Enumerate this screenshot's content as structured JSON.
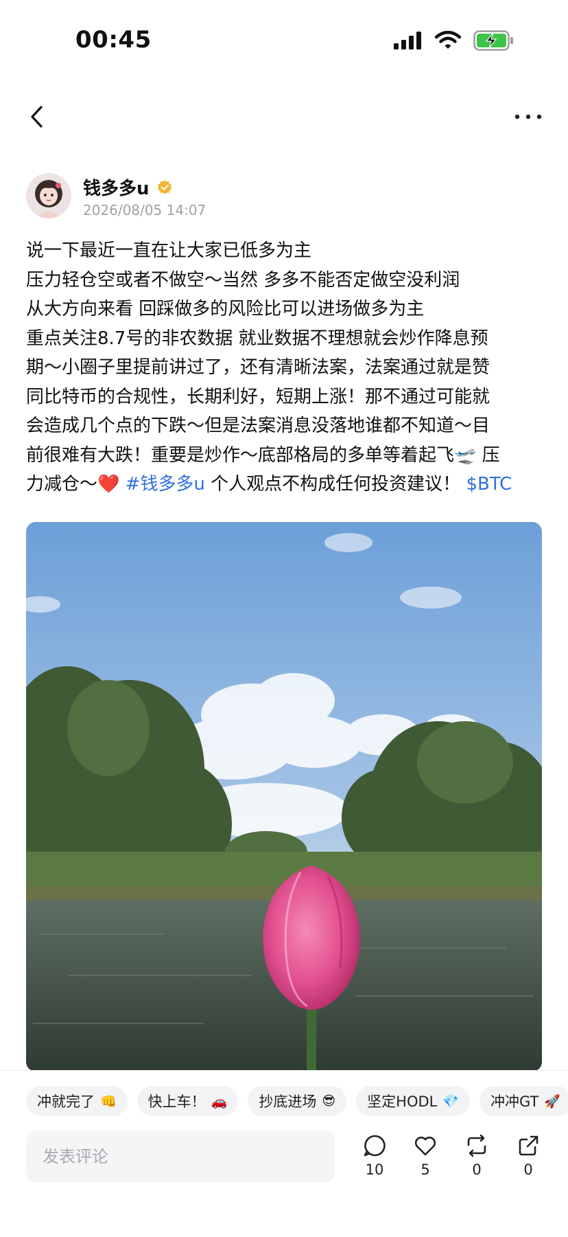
{
  "status_bar": {
    "time": "00:45"
  },
  "author": {
    "name": "钱多多u",
    "post_time": "2026/08/05 14:07"
  },
  "post": {
    "lines": [
      "说一下最近一直在让大家已低多为主",
      "压力轻仓空或者不做空～当然 多多不能否定做空没利润",
      "从大方向来看 回踩做多的风险比可以进场做多为主",
      "重点关注8.7号的非农数据  就业数据不理想就会炒作降息预",
      "期～小圈子里提前讲过了，还有清晰法案，法案通过就是赞",
      "同比特币的合规性，长期利好，短期上涨！那不通过可能就",
      "会造成几个点的下跌～但是法案消息没落地谁都不知道～目",
      "前很难有大跌！重要是炒作～底部格局的多单等着起飞🛫 压"
    ],
    "last_line_prefix": "力减仓～❤️ ",
    "hashtag": "#钱多多u",
    "last_line_middle": " 个人观点不构成任何投资建议！ ",
    "ticker": "$BTC"
  },
  "chips": [
    {
      "label": "冲就完了",
      "emoji": "👊"
    },
    {
      "label": "快上车！",
      "emoji": "🚗"
    },
    {
      "label": "抄底进场",
      "emoji": "😎"
    },
    {
      "label": "坚定HODL",
      "emoji": "💎"
    },
    {
      "label": "冲冲GT",
      "emoji": "🚀"
    }
  ],
  "comment": {
    "placeholder": "发表评论"
  },
  "actions": {
    "comments": "10",
    "likes": "5",
    "reposts": "0",
    "shares": "0"
  },
  "colors": {
    "link": "#2f6fe0",
    "verified_badge": "#f2b632",
    "battery": "#3bc34a"
  },
  "icons": [
    "signal-icon",
    "wifi-icon",
    "battery-charging-icon",
    "back-chevron-icon",
    "more-dots-icon",
    "verified-badge-icon",
    "comment-icon",
    "heart-icon",
    "repost-icon",
    "share-icon"
  ]
}
